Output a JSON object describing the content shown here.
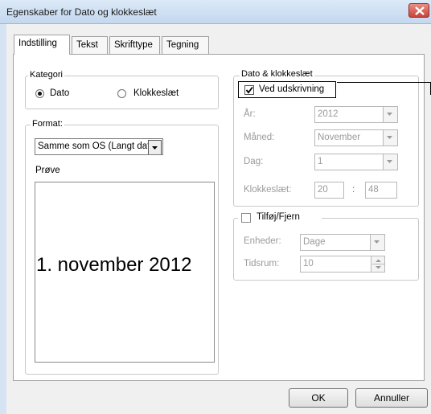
{
  "window": {
    "title": "Egenskaber for Dato og klokkeslæt"
  },
  "tabs": [
    {
      "label": "Indstilling"
    },
    {
      "label": "Tekst"
    },
    {
      "label": "Skrifttype"
    },
    {
      "label": "Tegning"
    }
  ],
  "kategori": {
    "legend": "Kategori",
    "options": [
      {
        "label": "Dato",
        "selected": true
      },
      {
        "label": "Klokkeslæt",
        "selected": false
      }
    ]
  },
  "format": {
    "legend": "Format:",
    "selected": "Samme som OS (Langt dato)",
    "preview_label": "Prøve",
    "preview_text": "1. november 2012"
  },
  "datetime": {
    "legend": "Dato & klokkeslæt",
    "print_label": "Ved udskrivning",
    "print_checked": true,
    "year_label": "År:",
    "year_value": "2012",
    "month_label": "Måned:",
    "month_value": "November",
    "day_label": "Dag:",
    "day_value": "1",
    "time_label": "Klokkeslæt:",
    "hour_value": "20",
    "time_sep": ":",
    "minute_value": "48"
  },
  "addremove": {
    "legend": "Tilføj/Fjern",
    "checked": false,
    "unit_label": "Enheder:",
    "unit_value": "Dage",
    "period_label": "Tidsrum:",
    "period_value": "10"
  },
  "buttons": {
    "ok": "OK",
    "cancel": "Annuller"
  }
}
